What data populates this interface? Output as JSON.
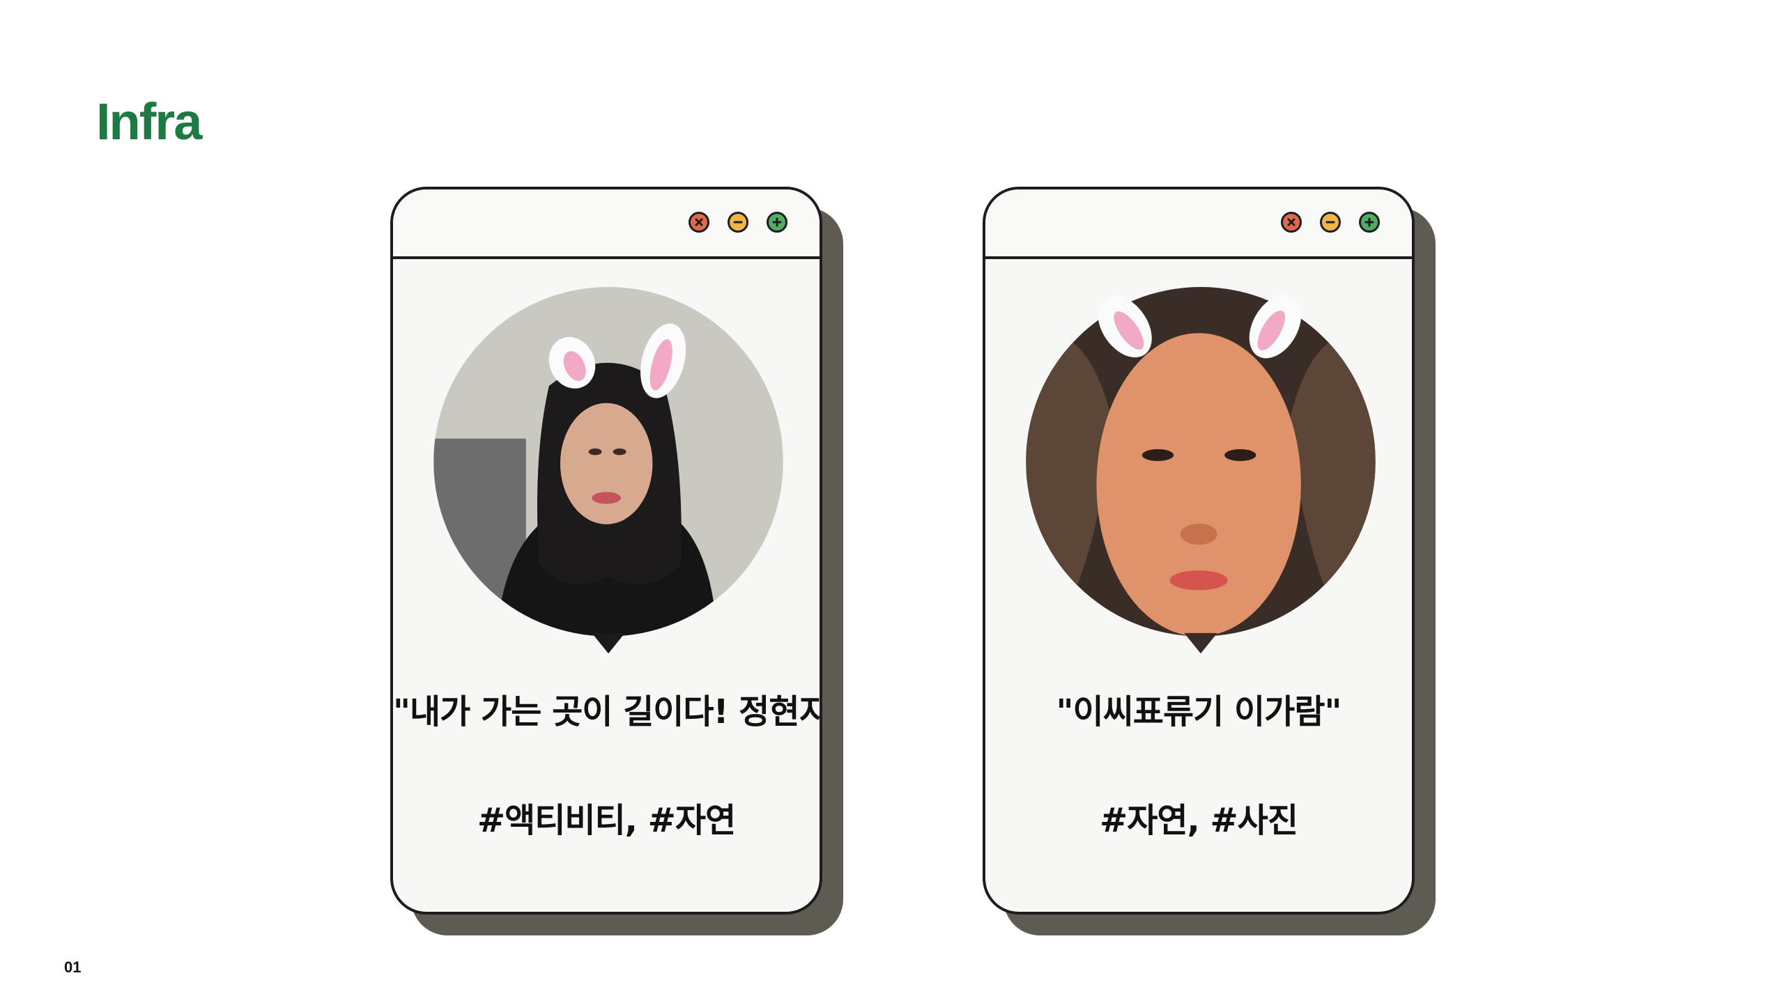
{
  "slide": {
    "title": "Infra",
    "page_number": "01"
  },
  "colors": {
    "title": "#1e7a43",
    "close": "#e0694c",
    "minimize": "#f0b545",
    "maximize": "#4fae63",
    "card_shadow": "#5e5b52"
  },
  "window_controls": {
    "close_icon": "close-icon",
    "minimize_icon": "minus-icon",
    "maximize_icon": "plus-icon"
  },
  "cards": [
    {
      "quote": "\"내가 가는 곳이 길이다! 정현지\"",
      "hashtags": "#액티비티, #자연"
    },
    {
      "quote": "\"이씨표류기 이가람\"",
      "hashtags": "#자연, #사진"
    }
  ]
}
